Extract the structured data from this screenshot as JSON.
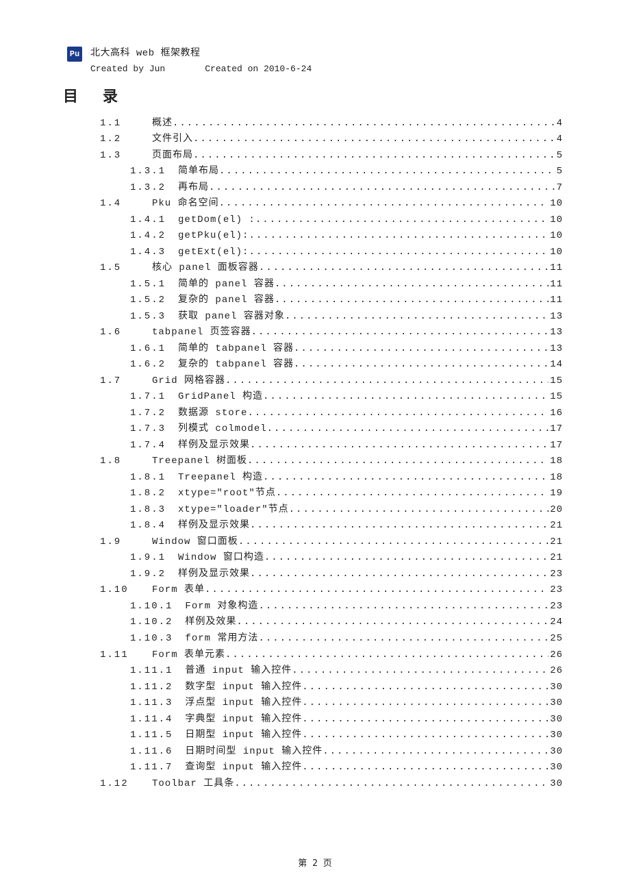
{
  "header": {
    "logo_text": "Pu",
    "title": "北大高科 web 框架教程",
    "created_by_label": "Created by Jun",
    "created_on_label": "Created on 2010-6-24"
  },
  "toc_heading": "目录",
  "footer": "第 2 页",
  "toc": [
    {
      "level": 1,
      "num": "1.1",
      "label": "概述",
      "page": "4"
    },
    {
      "level": 1,
      "num": "1.2",
      "label": "文件引入",
      "page": "4"
    },
    {
      "level": 1,
      "num": "1.3",
      "label": "页面布局",
      "page": "5"
    },
    {
      "level": 2,
      "num": "1.3.1",
      "label": "简单布局",
      "page": "5"
    },
    {
      "level": 2,
      "num": "1.3.2",
      "label": "再布局",
      "page": "7"
    },
    {
      "level": 1,
      "num": "1.4",
      "label": "Pku 命名空间",
      "page": "10"
    },
    {
      "level": 2,
      "num": "1.4.1",
      "label": "getDom(el) :",
      "page": "10"
    },
    {
      "level": 2,
      "num": "1.4.2",
      "label": "getPku(el):",
      "page": "10"
    },
    {
      "level": 2,
      "num": "1.4.3",
      "label": "getExt(el):",
      "page": "10"
    },
    {
      "level": 1,
      "num": "1.5",
      "label": "核心 panel 面板容器",
      "page": "11"
    },
    {
      "level": 2,
      "num": "1.5.1",
      "label": "简单的 panel 容器",
      "page": "11"
    },
    {
      "level": 2,
      "num": "1.5.2",
      "label": "复杂的 panel 容器",
      "page": "11"
    },
    {
      "level": 2,
      "num": "1.5.3",
      "label": "获取 panel 容器对象",
      "page": "13"
    },
    {
      "level": 1,
      "num": "1.6",
      "label": "tabpanel 页签容器",
      "page": "13"
    },
    {
      "level": 2,
      "num": "1.6.1",
      "label": "简单的 tabpanel 容器",
      "page": "13"
    },
    {
      "level": 2,
      "num": "1.6.2",
      "label": "复杂的 tabpanel 容器",
      "page": "14"
    },
    {
      "level": 1,
      "num": "1.7",
      "label": "Grid 网格容器",
      "page": "15"
    },
    {
      "level": 2,
      "num": "1.7.1",
      "label": "GridPanel 构造",
      "page": "15"
    },
    {
      "level": 2,
      "num": "1.7.2",
      "label": "数据源 store",
      "page": "16"
    },
    {
      "level": 2,
      "num": "1.7.3",
      "label": "列模式 colmodel",
      "page": "17"
    },
    {
      "level": 2,
      "num": "1.7.4",
      "label": "样例及显示效果",
      "page": "17"
    },
    {
      "level": 1,
      "num": "1.8",
      "label": "Treepanel 树面板",
      "page": "18"
    },
    {
      "level": 2,
      "num": "1.8.1",
      "label": "Treepanel 构造",
      "page": "18"
    },
    {
      "level": 2,
      "num": "1.8.2",
      "label": "xtype=\"root\"节点",
      "page": "19"
    },
    {
      "level": 2,
      "num": "1.8.3",
      "label": "xtype=\"loader\"节点",
      "page": "20"
    },
    {
      "level": 2,
      "num": "1.8.4",
      "label": "样例及显示效果",
      "page": "21"
    },
    {
      "level": 1,
      "num": "1.9",
      "label": "Window 窗口面板",
      "page": "21"
    },
    {
      "level": 2,
      "num": "1.9.1",
      "label": "Window 窗口构造",
      "page": "21"
    },
    {
      "level": 2,
      "num": "1.9.2",
      "label": "样例及显示效果",
      "page": "23"
    },
    {
      "level": 1,
      "num": "1.10",
      "label": "Form 表单",
      "page": "23"
    },
    {
      "level": 2,
      "num": "1.10.1",
      "label": "Form 对象构造",
      "page": "23"
    },
    {
      "level": 2,
      "num": "1.10.2",
      "label": "样例及效果",
      "page": "24"
    },
    {
      "level": 2,
      "num": "1.10.3",
      "label": "form 常用方法",
      "page": "25"
    },
    {
      "level": 1,
      "num": "1.11",
      "label": "Form 表单元素",
      "page": "26"
    },
    {
      "level": 2,
      "num": "1.11.1",
      "label": "普通 input 输入控件",
      "page": "26"
    },
    {
      "level": 2,
      "num": "1.11.2",
      "label": "数字型 input 输入控件",
      "page": "30"
    },
    {
      "level": 2,
      "num": "1.11.3",
      "label": "浮点型 input 输入控件",
      "page": "30"
    },
    {
      "level": 2,
      "num": "1.11.4",
      "label": "字典型 input 输入控件",
      "page": "30"
    },
    {
      "level": 2,
      "num": "1.11.5",
      "label": "日期型 input 输入控件",
      "page": "30"
    },
    {
      "level": 2,
      "num": "1.11.6",
      "label": "日期时间型 input 输入控件",
      "page": "30"
    },
    {
      "level": 2,
      "num": "1.11.7",
      "label": "查询型 input 输入控件",
      "page": "30"
    },
    {
      "level": 1,
      "num": "1.12",
      "label": "Toolbar 工具条",
      "page": "30"
    }
  ]
}
